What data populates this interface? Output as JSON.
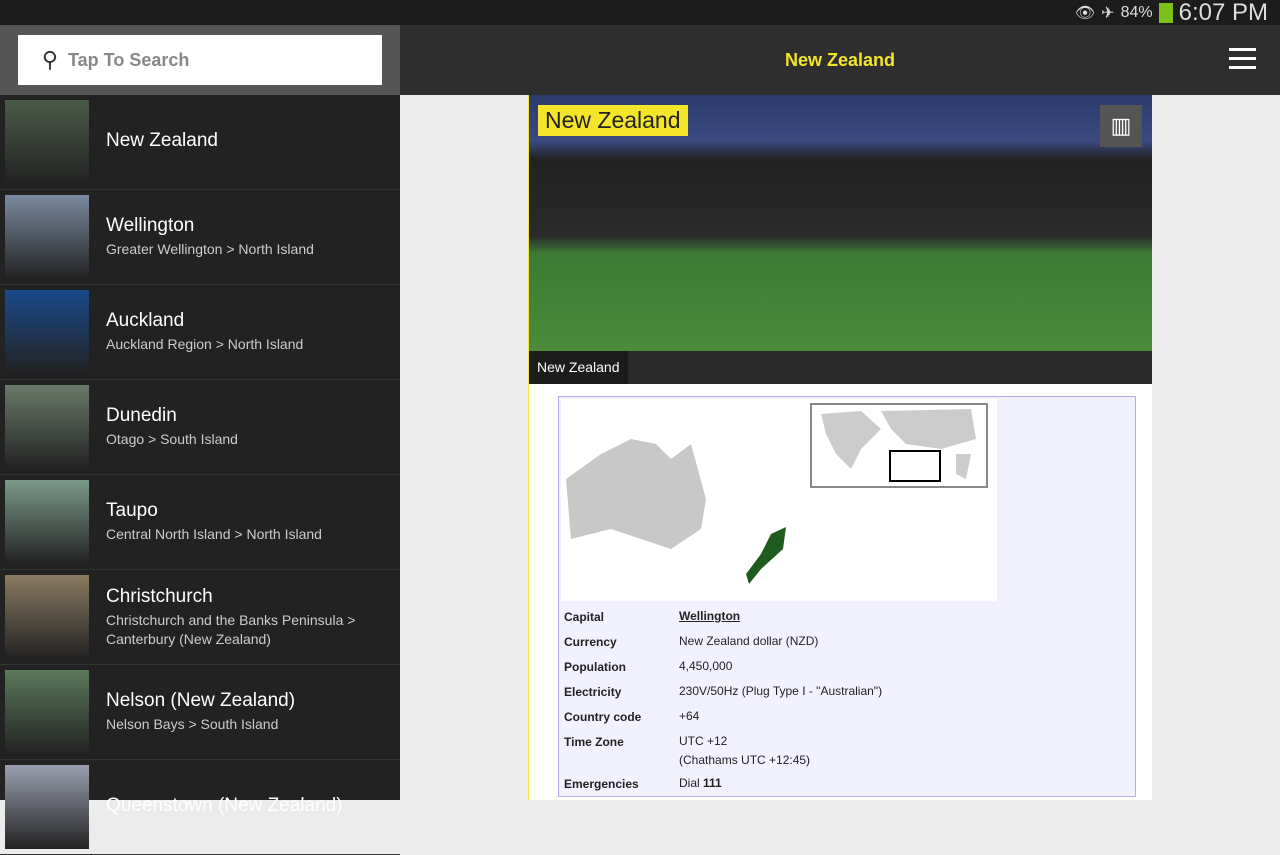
{
  "status": {
    "battery": "84%",
    "time": "6:07 PM",
    "icons": [
      "eye-icon",
      "airplane-icon",
      "battery-icon"
    ]
  },
  "search": {
    "placeholder": "Tap To Search"
  },
  "list": [
    {
      "title": "New Zealand",
      "subtitle": "",
      "color": "#4a5a48"
    },
    {
      "title": "Wellington",
      "subtitle": "Greater Wellington > North Island",
      "color": "#7a8aa0"
    },
    {
      "title": "Auckland",
      "subtitle": "Auckland Region > North Island",
      "color": "#1a4a8a"
    },
    {
      "title": "Dunedin",
      "subtitle": "Otago > South Island",
      "color": "#6a7a6a"
    },
    {
      "title": "Taupo",
      "subtitle": "Central North Island > North Island",
      "color": "#7a9a8a"
    },
    {
      "title": "Christchurch",
      "subtitle": "Christchurch and the Banks Peninsula > Canterbury (New Zealand)",
      "color": "#8a7a60"
    },
    {
      "title": "Nelson (New Zealand)",
      "subtitle": "Nelson Bays > South Island",
      "color": "#5a7a5a"
    },
    {
      "title": "Queenstown (New Zealand)",
      "subtitle": "",
      "color": "#9aa0b0"
    }
  ],
  "header": {
    "title": "New Zealand"
  },
  "article": {
    "hero_label": "New Zealand",
    "caption": "New Zealand",
    "facts": [
      {
        "k": "Capital",
        "v": "Wellington"
      },
      {
        "k": "Currency",
        "v": "New Zealand dollar (NZD)"
      },
      {
        "k": "Population",
        "v": "4,450,000"
      },
      {
        "k": "Electricity",
        "v": "230V/50Hz (Plug Type I - \"Australian\")"
      },
      {
        "k": "Country code",
        "v": "+64"
      },
      {
        "k": "Time Zone",
        "v": "UTC +12",
        "v2": "(Chathams UTC +12:45)"
      },
      {
        "k": "Emergencies",
        "v": "Dial ",
        "v2": "111"
      }
    ]
  }
}
